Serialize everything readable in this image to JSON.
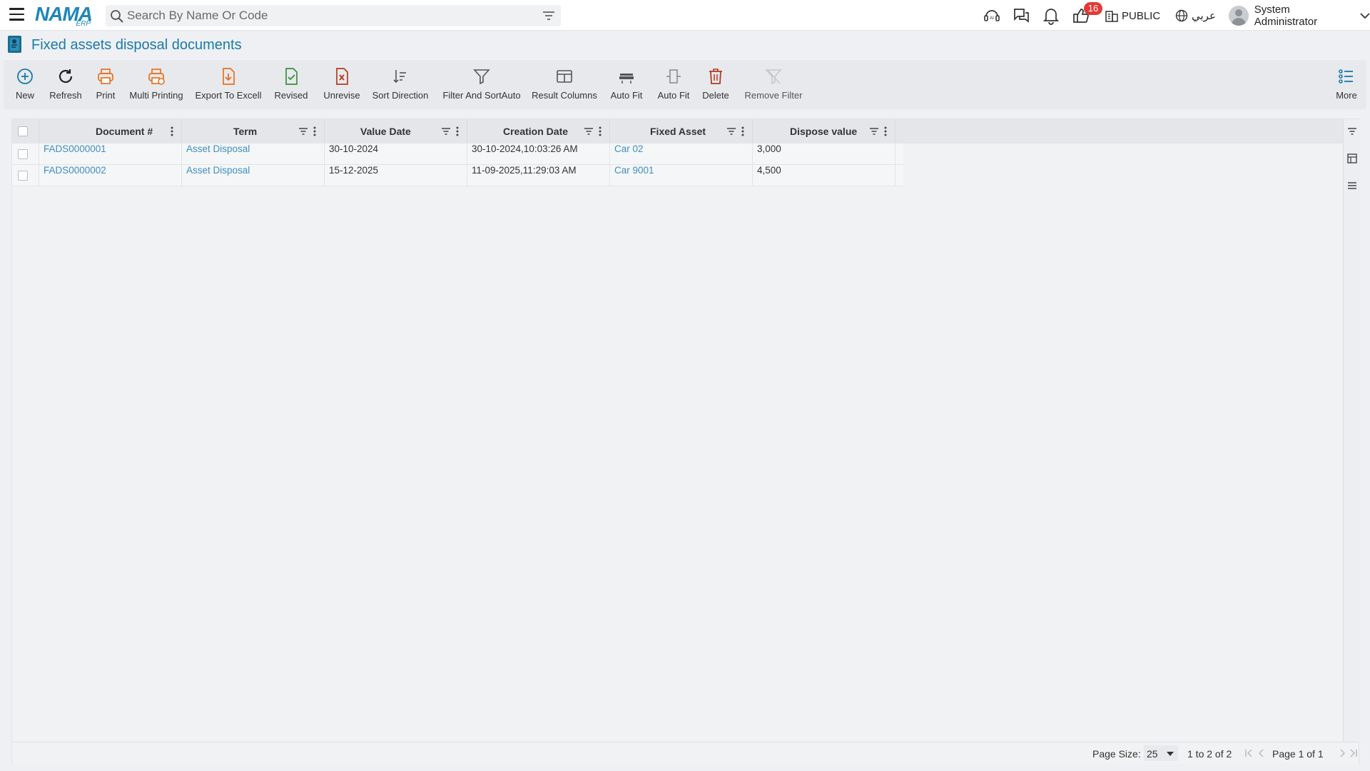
{
  "topbar": {
    "logo_main": "NAMA",
    "logo_sub": "ERP",
    "search_placeholder": "Search By Name Or Code",
    "notification_count": "16",
    "branch": "PUBLIC",
    "language": "عربي",
    "user_name": "System Administrator"
  },
  "page": {
    "title": "Fixed assets disposal documents"
  },
  "toolbar": {
    "new": "New",
    "refresh": "Refresh",
    "print": "Print",
    "multi_printing": "Multi Printing",
    "export": "Export To Excell",
    "revised": "Revised",
    "unrevise": "Unrevise",
    "sort_direction": "Sort Direction",
    "filter_sort": "Filter And SortAuto",
    "result_columns": "Result Columns",
    "auto_fit_1": "Auto Fit",
    "auto_fit_2": "Auto Fit",
    "delete": "Delete",
    "remove_filter": "Remove Filter",
    "more": "More"
  },
  "grid": {
    "columns": [
      "Document #",
      "Term",
      "Value Date",
      "Creation Date",
      "Fixed Asset",
      "Dispose value"
    ],
    "rows": [
      [
        "FADS0000001",
        "Asset Disposal",
        "30-10-2024",
        "30-10-2024,10:03:26 AM",
        "Car 02",
        "3,000"
      ],
      [
        "FADS0000002",
        "Asset Disposal",
        "15-12-2025",
        "11-09-2025,11:29:03 AM",
        "Car 9001",
        "4,500"
      ]
    ]
  },
  "footer": {
    "page_size_label": "Page Size:",
    "page_size_value": "25",
    "range": "1 to 2 of 2",
    "page_info": "Page 1 of 1"
  },
  "colors": {
    "accent": "#1a7aa8",
    "link": "#3d8fbf",
    "badge": "#e53935",
    "print_orange": "#e8711f",
    "revised_green": "#3a8f3e",
    "delete_red": "#b23a1f"
  }
}
